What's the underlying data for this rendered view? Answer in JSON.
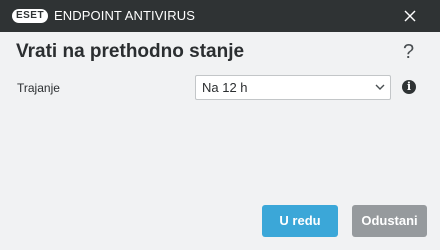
{
  "titlebar": {
    "brand_logo": "ESET",
    "product_name": "ENDPOINT ANTIVIRUS",
    "close_icon": "close-icon"
  },
  "dialog": {
    "title": "Vrati na prethodno stanje",
    "help_icon_glyph": "?"
  },
  "form": {
    "duration_label": "Trajanje",
    "duration_value": "Na 12 h",
    "info_icon_glyph": "i"
  },
  "buttons": {
    "ok_label": "U redu",
    "cancel_label": "Odustani"
  },
  "colors": {
    "titlebar_bg": "#2f3334",
    "page_bg": "#f1f2f3",
    "primary_button": "#3ba7d8",
    "secondary_button": "#969a9d"
  }
}
